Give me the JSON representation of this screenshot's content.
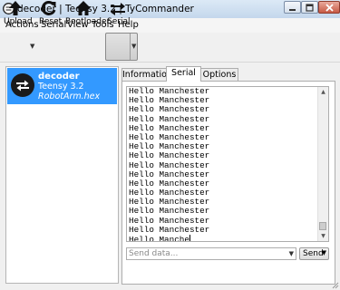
{
  "window": {
    "title": "decoder | Teensy 3.2 | TyCommander",
    "controls": [
      "minimize",
      "maximize",
      "close"
    ]
  },
  "menu": [
    "Actions",
    "Serial",
    "View",
    "Tools",
    "Help"
  ],
  "toolbar": {
    "upload": "Upload",
    "reset": "Reset",
    "bootloader": "Bootloader",
    "serial": "Serial"
  },
  "board": {
    "name": "decoder",
    "model": "Teensy 3.2",
    "firmware": "RobotArm.hex"
  },
  "tabs": [
    "Information",
    "Serial",
    "Options"
  ],
  "active_tab": "Serial",
  "console": {
    "lines": [
      "Hello Manchester",
      "Hello Manchester",
      "Hello Manchester",
      "Hello Manchester",
      "Hello Manchester",
      "Hello Manchester",
      "Hello Manchester",
      "Hello Manchester",
      "Hello Manchester",
      "Hello Manchester",
      "Hello Manchester",
      "Hello Manchester",
      "Hello Manchester",
      "Hello Manchester",
      "Hello Manchester",
      "Hello Manchester"
    ],
    "partial_line": "Hello Manche"
  },
  "send": {
    "placeholder": "Send data...",
    "button": "Send"
  },
  "colors": {
    "selection": "#3399ff",
    "titlebar": "#c4d7ec"
  }
}
